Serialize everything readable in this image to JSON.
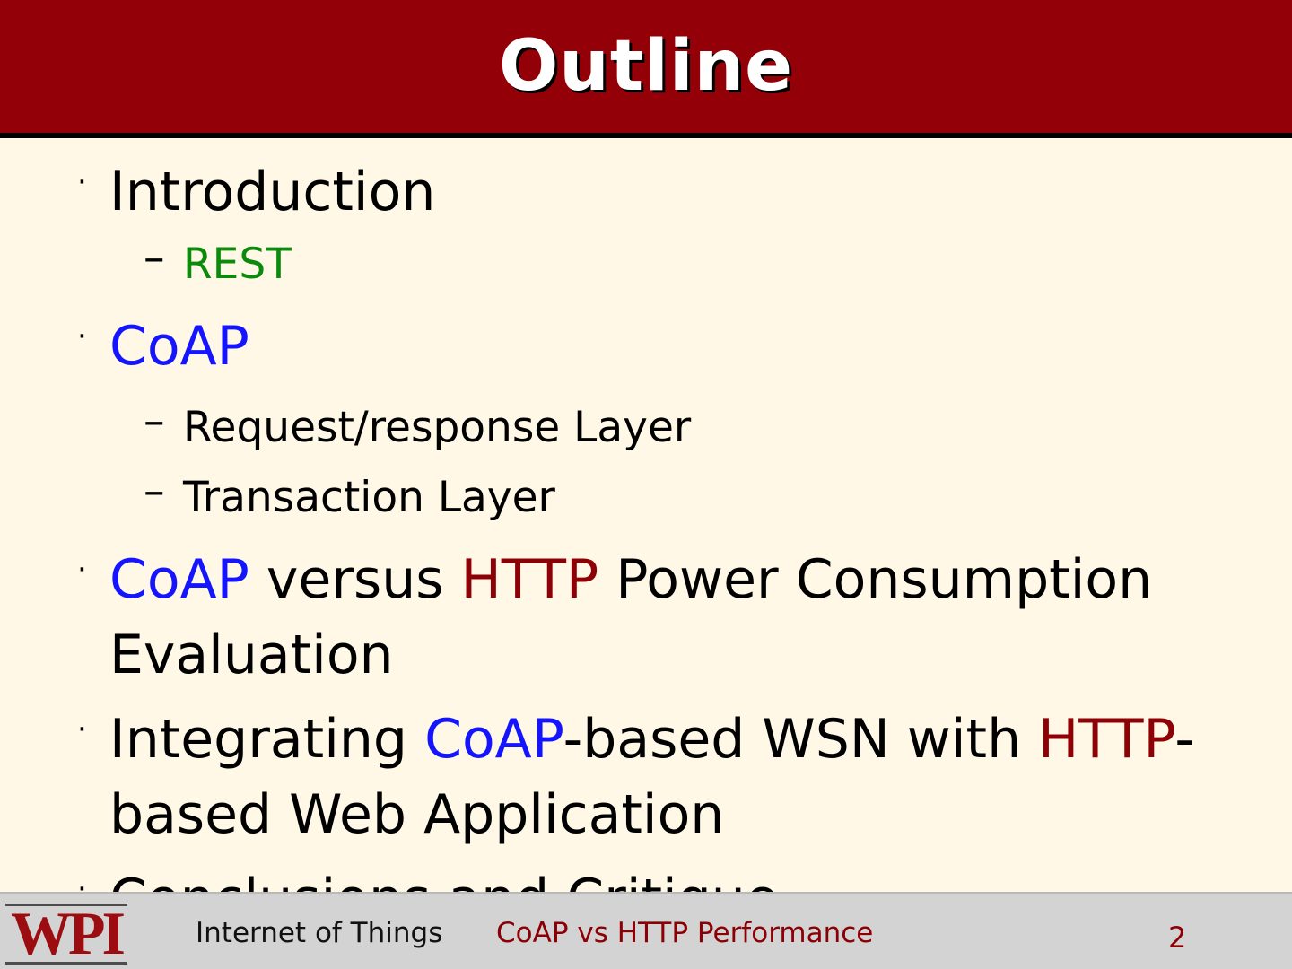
{
  "slide": {
    "title": "Outline"
  },
  "outline": {
    "introduction": "Introduction",
    "rest": "REST",
    "coap": "CoAP",
    "request_response_layer": "Request/response Layer",
    "transaction_layer": "Transaction Layer",
    "comparison_coap": "CoAP",
    "comparison_versus": " versus ",
    "comparison_http": "HTTP",
    "comparison_tail": " Power Consumption",
    "comparison_evaluation": "Evaluation",
    "integration_prefix": "Integrating ",
    "integration_coap": "CoAP",
    "integration_middle": "-based WSN with ",
    "integration_http": "HTTP",
    "integration_dash": "-",
    "integration_second_line": "based Web Application",
    "conclusions": "Conclusions and Critique",
    "bullet_symbol": "·",
    "sub_bullet_symbol": "–"
  },
  "footer": {
    "logo": "WPI",
    "course": "Internet of Things",
    "topic": "CoAP vs HTTP Performance",
    "page_number": "2"
  },
  "colors": {
    "title_bar": "#930008",
    "slide_background": "#fff8e6",
    "coap_text": "#1414ff",
    "http_text": "#8d0005",
    "rest_text": "#0c8a0c",
    "footer_background": "#d3d3d3"
  }
}
